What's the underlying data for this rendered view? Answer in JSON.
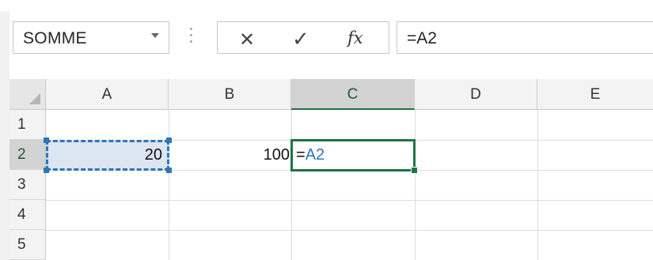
{
  "name_box": {
    "value": "SOMME"
  },
  "formula_bar": {
    "cancel_symbol": "✕",
    "enter_symbol": "✓",
    "function_symbol": "fx",
    "content": "=A2"
  },
  "columns": [
    "A",
    "B",
    "C",
    "D",
    "E"
  ],
  "rows": [
    "1",
    "2",
    "3",
    "4",
    "5"
  ],
  "cells": {
    "A2": "20",
    "B2": "100",
    "C2_prefix": "=",
    "C2_ref": "A2"
  },
  "colors": {
    "active_border": "#217346",
    "reference_color": "#2e75b6",
    "reference_fill": "#dce6f1"
  },
  "icons": [
    "chevron-down-icon",
    "cancel-icon",
    "enter-icon",
    "insert-function-icon",
    "select-all-icon",
    "fill-handle-icon"
  ]
}
